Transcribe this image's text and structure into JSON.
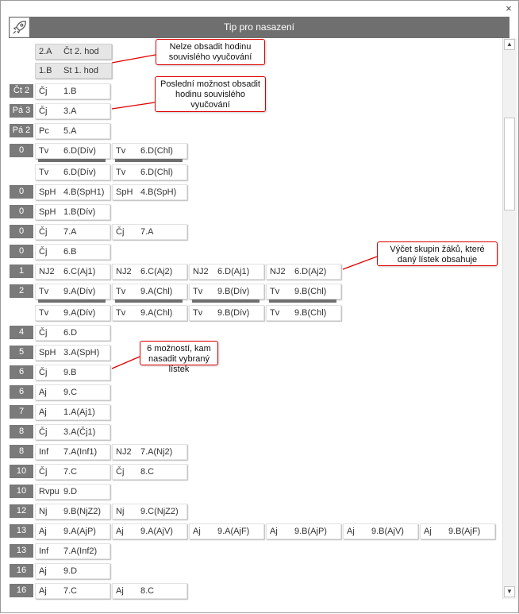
{
  "window": {
    "title": "Tip pro nasazení",
    "close_symbol": "×"
  },
  "scrollbar": {
    "up_symbol": "▲",
    "down_symbol": "▼"
  },
  "header_rows": [
    {
      "subject": "2.A",
      "class": "Čt 2. hod"
    },
    {
      "subject": "1.B",
      "class": "St 1. hod"
    }
  ],
  "rows": [
    {
      "badge": "Čt 2",
      "cells": [
        {
          "s": "Čj",
          "c": "1.B"
        }
      ]
    },
    {
      "badge": "Pá 3",
      "cells": [
        {
          "s": "Čj",
          "c": "3.A"
        }
      ]
    },
    {
      "badge": "Pá 2",
      "cells": [
        {
          "s": "Pc",
          "c": "5.A"
        }
      ]
    },
    {
      "badge": "0",
      "cells": [
        {
          "s": "Tv",
          "c": "6.D(Dív)"
        },
        {
          "s": "Tv",
          "c": "6.D(Chl)"
        }
      ],
      "bar": true
    },
    {
      "badge": "",
      "cells": [
        {
          "s": "Tv",
          "c": "6.D(Dív)"
        },
        {
          "s": "Tv",
          "c": "6.D(Chl)"
        }
      ]
    },
    {
      "badge": "0",
      "cells": [
        {
          "s": "SpH",
          "c": "4.B(SpH1)"
        },
        {
          "s": "SpH",
          "c": "4.B(SpH)"
        }
      ]
    },
    {
      "badge": "0",
      "cells": [
        {
          "s": "SpH",
          "c": "1.B(Dív)"
        }
      ]
    },
    {
      "badge": "0",
      "cells": [
        {
          "s": "Čj",
          "c": "7.A"
        },
        {
          "s": "Čj",
          "c": "7.A"
        }
      ]
    },
    {
      "badge": "0",
      "cells": [
        {
          "s": "Čj",
          "c": "6.B"
        }
      ]
    },
    {
      "badge": "1",
      "cells": [
        {
          "s": "NJ2",
          "c": "6.C(Aj1)"
        },
        {
          "s": "NJ2",
          "c": "6.C(Aj2)"
        },
        {
          "s": "NJ2",
          "c": "6.D(Aj1)"
        },
        {
          "s": "NJ2",
          "c": "6.D(Aj2)"
        }
      ]
    },
    {
      "badge": "2",
      "cells": [
        {
          "s": "Tv",
          "c": "9.A(Dív)"
        },
        {
          "s": "Tv",
          "c": "9.A(Chl)"
        },
        {
          "s": "Tv",
          "c": "9.B(Dív)"
        },
        {
          "s": "Tv",
          "c": "9.B(Chl)"
        }
      ],
      "bar": true
    },
    {
      "badge": "",
      "cells": [
        {
          "s": "Tv",
          "c": "9.A(Dív)"
        },
        {
          "s": "Tv",
          "c": "9.A(Chl)"
        },
        {
          "s": "Tv",
          "c": "9.B(Dív)"
        },
        {
          "s": "Tv",
          "c": "9.B(Chl)"
        }
      ]
    },
    {
      "badge": "4",
      "cells": [
        {
          "s": "Čj",
          "c": "6.D"
        }
      ]
    },
    {
      "badge": "5",
      "cells": [
        {
          "s": "SpH",
          "c": "3.A(SpH)"
        }
      ]
    },
    {
      "badge": "6",
      "cells": [
        {
          "s": "Čj",
          "c": "9.B"
        }
      ]
    },
    {
      "badge": "6",
      "cells": [
        {
          "s": "Aj",
          "c": "9.C"
        }
      ]
    },
    {
      "badge": "7",
      "cells": [
        {
          "s": "Aj",
          "c": "1.A(Aj1)"
        }
      ]
    },
    {
      "badge": "8",
      "cells": [
        {
          "s": "Čj",
          "c": "3.A(Čj1)"
        }
      ]
    },
    {
      "badge": "8",
      "cells": [
        {
          "s": "Inf",
          "c": "7.A(Inf1)"
        },
        {
          "s": "NJ2",
          "c": "7.A(Nj2)"
        }
      ]
    },
    {
      "badge": "10",
      "cells": [
        {
          "s": "Čj",
          "c": "7.C"
        },
        {
          "s": "Čj",
          "c": "8.C"
        }
      ]
    },
    {
      "badge": "10",
      "cells": [
        {
          "s": "Rvpu",
          "c": "9.D"
        }
      ]
    },
    {
      "badge": "12",
      "cells": [
        {
          "s": "Nj",
          "c": "9.B(NjZ2)"
        },
        {
          "s": "Nj",
          "c": "9.C(NjZ2)"
        }
      ]
    },
    {
      "badge": "13",
      "cells": [
        {
          "s": "Aj",
          "c": "9.A(AjP)"
        },
        {
          "s": "Aj",
          "c": "9.A(AjV)"
        },
        {
          "s": "Aj",
          "c": "9.A(AjF)"
        },
        {
          "s": "Aj",
          "c": "9.B(AjP)"
        },
        {
          "s": "Aj",
          "c": "9.B(AjV)"
        },
        {
          "s": "Aj",
          "c": "9.B(AjF)"
        }
      ]
    },
    {
      "badge": "13",
      "cells": [
        {
          "s": "Inf",
          "c": "7.A(Inf2)"
        }
      ]
    },
    {
      "badge": "16",
      "cells": [
        {
          "s": "Aj",
          "c": "9.D"
        }
      ]
    },
    {
      "badge": "16",
      "cells": [
        {
          "s": "Aj",
          "c": "7.C"
        },
        {
          "s": "Aj",
          "c": "8.C"
        }
      ]
    }
  ],
  "callouts": [
    {
      "text": "Nelze obsadit hodinu souvislého vyučování"
    },
    {
      "text": "Poslední možnost obsadit hodinu souvislého vyučování"
    },
    {
      "text": "Výčet skupin žáků, které daný lístek obsahuje"
    },
    {
      "text": "6 možností, kam nasadit vybraný lístek"
    }
  ],
  "colors": {
    "header": "#6f6f6f",
    "badge": "#7a7a7a",
    "callout_border": "#e00000"
  }
}
